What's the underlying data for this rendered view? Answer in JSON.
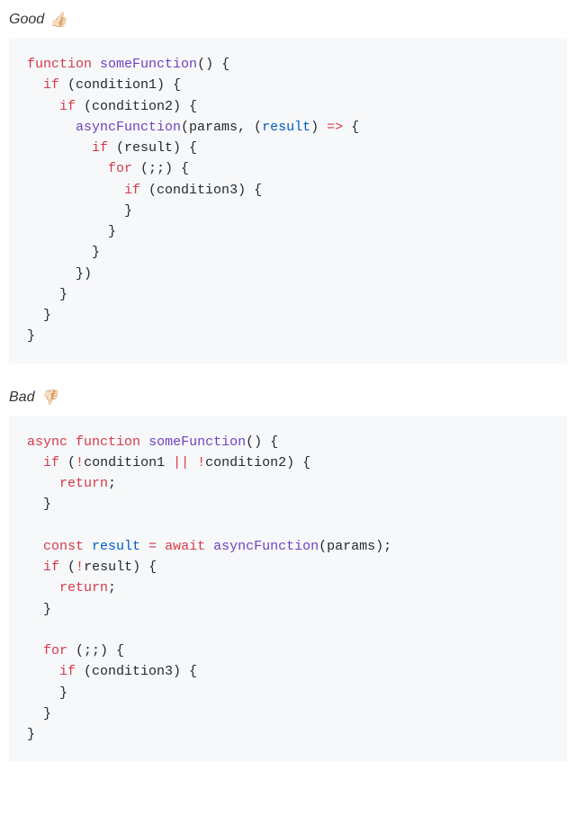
{
  "good": {
    "label": "Good",
    "emoji": "👍🏻",
    "code": [
      [
        [
          "kw",
          "function"
        ],
        [
          "pn",
          " "
        ],
        [
          "fn",
          "someFunction"
        ],
        [
          "pn",
          "() {"
        ]
      ],
      [
        [
          "pn",
          "  "
        ],
        [
          "kw",
          "if"
        ],
        [
          "pn",
          " (condition1) {"
        ]
      ],
      [
        [
          "pn",
          "    "
        ],
        [
          "kw",
          "if"
        ],
        [
          "pn",
          " (condition2) {"
        ]
      ],
      [
        [
          "pn",
          "      "
        ],
        [
          "fn",
          "asyncFunction"
        ],
        [
          "pn",
          "(params, ("
        ],
        [
          "var",
          "result"
        ],
        [
          "pn",
          ") "
        ],
        [
          "op",
          "=>"
        ],
        [
          "pn",
          " {"
        ]
      ],
      [
        [
          "pn",
          "        "
        ],
        [
          "kw",
          "if"
        ],
        [
          "pn",
          " (result) {"
        ]
      ],
      [
        [
          "pn",
          "          "
        ],
        [
          "kw",
          "for"
        ],
        [
          "pn",
          " (;;) {"
        ]
      ],
      [
        [
          "pn",
          "            "
        ],
        [
          "kw",
          "if"
        ],
        [
          "pn",
          " (condition3) {"
        ]
      ],
      [
        [
          "pn",
          "            }"
        ]
      ],
      [
        [
          "pn",
          "          }"
        ]
      ],
      [
        [
          "pn",
          "        }"
        ]
      ],
      [
        [
          "pn",
          "      })"
        ]
      ],
      [
        [
          "pn",
          "    }"
        ]
      ],
      [
        [
          "pn",
          "  }"
        ]
      ],
      [
        [
          "pn",
          "}"
        ]
      ]
    ]
  },
  "bad": {
    "label": "Bad",
    "emoji": "👎🏻",
    "code": [
      [
        [
          "kw",
          "async"
        ],
        [
          "pn",
          " "
        ],
        [
          "kw",
          "function"
        ],
        [
          "pn",
          " "
        ],
        [
          "fn",
          "someFunction"
        ],
        [
          "pn",
          "() {"
        ]
      ],
      [
        [
          "pn",
          "  "
        ],
        [
          "kw",
          "if"
        ],
        [
          "pn",
          " ("
        ],
        [
          "op",
          "!"
        ],
        [
          "pn",
          "condition1 "
        ],
        [
          "op",
          "||"
        ],
        [
          "pn",
          " "
        ],
        [
          "op",
          "!"
        ],
        [
          "pn",
          "condition2) {"
        ]
      ],
      [
        [
          "pn",
          "    "
        ],
        [
          "kw",
          "return"
        ],
        [
          "pn",
          ";"
        ]
      ],
      [
        [
          "pn",
          "  }"
        ]
      ],
      [
        [
          "pn",
          ""
        ]
      ],
      [
        [
          "pn",
          "  "
        ],
        [
          "kw",
          "const"
        ],
        [
          "pn",
          " "
        ],
        [
          "var",
          "result"
        ],
        [
          "pn",
          " "
        ],
        [
          "op",
          "="
        ],
        [
          "pn",
          " "
        ],
        [
          "kw",
          "await"
        ],
        [
          "pn",
          " "
        ],
        [
          "fn",
          "asyncFunction"
        ],
        [
          "pn",
          "(params);"
        ]
      ],
      [
        [
          "pn",
          "  "
        ],
        [
          "kw",
          "if"
        ],
        [
          "pn",
          " ("
        ],
        [
          "op",
          "!"
        ],
        [
          "pn",
          "result) {"
        ]
      ],
      [
        [
          "pn",
          "    "
        ],
        [
          "kw",
          "return"
        ],
        [
          "pn",
          ";"
        ]
      ],
      [
        [
          "pn",
          "  }"
        ]
      ],
      [
        [
          "pn",
          ""
        ]
      ],
      [
        [
          "pn",
          "  "
        ],
        [
          "kw",
          "for"
        ],
        [
          "pn",
          " (;;) {"
        ]
      ],
      [
        [
          "pn",
          "    "
        ],
        [
          "kw",
          "if"
        ],
        [
          "pn",
          " (condition3) {"
        ]
      ],
      [
        [
          "pn",
          "    }"
        ]
      ],
      [
        [
          "pn",
          "  }"
        ]
      ],
      [
        [
          "pn",
          "}"
        ]
      ]
    ]
  }
}
